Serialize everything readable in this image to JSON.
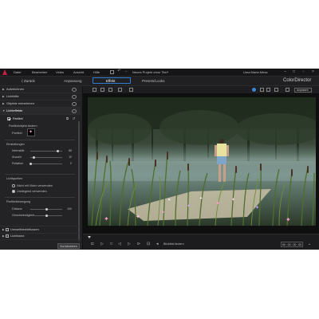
{
  "menu": {
    "items": [
      "Datei",
      "Bearbeiten",
      "Video",
      "Ansicht",
      "Hilfe"
    ],
    "document_title": "Neues Projekt ohne Titel*",
    "user": "Uma Maria Mesa"
  },
  "modules": {
    "back_label": "Zurück",
    "tabs": [
      "Anpassung",
      "Effekt",
      "Presets/Looks"
    ],
    "active_tab": "Effekt",
    "brand": "ColorDirector"
  },
  "left_panel": {
    "sections_top": [
      "Aufzeichnen",
      "Lichtblitz",
      "Objekte entnehmen",
      "Lichteffekte"
    ],
    "effect_name": "Partikel",
    "effect_enabled": true,
    "subsection": "Partikelobjekt ändern",
    "object_label": "Partikel",
    "settings_heading": "Einstellungen",
    "settings": [
      {
        "label": "Intensität",
        "value": "85",
        "level": 0.85
      },
      {
        "label": "Anzahl",
        "value": "10",
        "level": 0.1
      },
      {
        "label": "Rotation",
        "value": "0",
        "level": 0.0
      }
    ],
    "source_heading": "Lichtquellen",
    "source_options": [
      {
        "label": "Nicht mit Video verwenden",
        "selected": false
      },
      {
        "label": "Umliegend verwenden",
        "selected": true
      }
    ],
    "transition_heading": "Partikelbewegung",
    "motion": [
      {
        "label": "Distanz",
        "value": "100",
        "level": 0.5
      },
      {
        "label": "Geschwindigkeit",
        "value": "",
        "level": 0.5
      }
    ],
    "sections_bottom": [
      "Umweltbeeinflussen",
      "Lichtband"
    ],
    "reset_label": "Zurücksetzen"
  },
  "preview": {
    "dropdown": "Anpassen",
    "mode": "Blickfeld ändern",
    "timecode": "00 : 00 : 00 : 00"
  },
  "colors": {
    "accent": "#2f7fd0",
    "logo": "#c82040",
    "particles": "#ff9ad2"
  }
}
